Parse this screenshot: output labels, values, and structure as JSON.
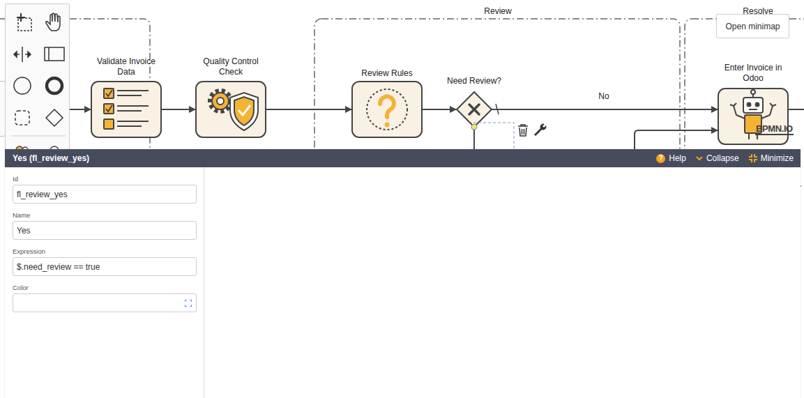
{
  "diagram": {
    "groups": [
      {
        "label": "Review"
      },
      {
        "label": "Resolve"
      }
    ],
    "tasks": [
      {
        "label": "Validate Invoice Data"
      },
      {
        "label": "Quality Control Check"
      },
      {
        "label": "Review Rules"
      },
      {
        "label": "Enter Invoice in Odoo"
      }
    ],
    "gateway": {
      "label": "Need Review?"
    },
    "no_flow": {
      "label": "No",
      "selected": false
    },
    "yes_flow": {
      "selected": true
    },
    "watermark": "BPMN.IO"
  },
  "minimap_button": "Open minimap",
  "properties": {
    "title": "Yes (fl_review_yes)",
    "actions": [
      {
        "icon": "?",
        "label": "Help"
      },
      {
        "label": "Collapse"
      },
      {
        "label": "Minimize"
      }
    ],
    "fields": [
      {
        "label": "Id",
        "value": "fl_review_yes"
      },
      {
        "label": "Name",
        "value": "Yes"
      },
      {
        "label": "Expression",
        "value": "$.need_review == true"
      },
      {
        "label": "Color",
        "value": ""
      }
    ]
  }
}
